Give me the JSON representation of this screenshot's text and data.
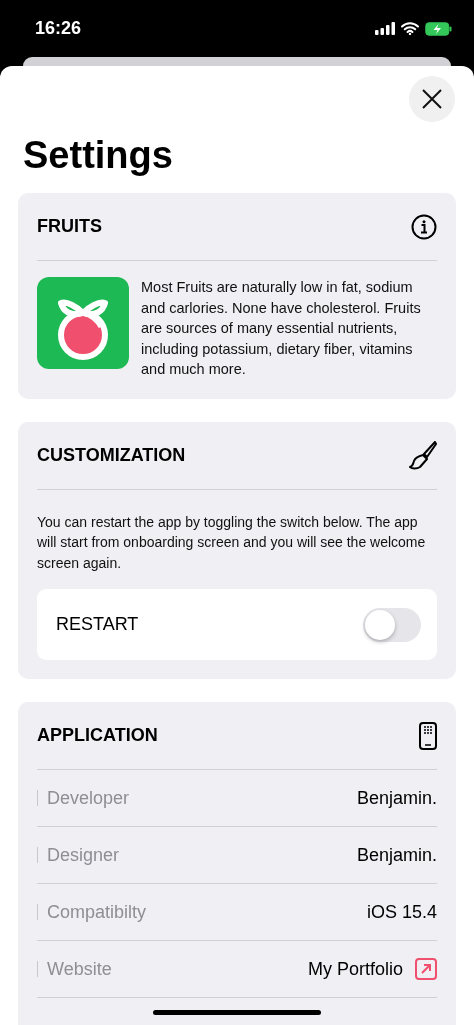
{
  "status_bar": {
    "time": "16:26"
  },
  "title": "Settings",
  "fruits": {
    "heading": "FRUITS",
    "text": "Most Fruits are naturally low in fat, sodium and carlories. None have cholesterol. Fruits are sources of many essential nutrients, including potassium, dietary fiber, vitamins and much more."
  },
  "customization": {
    "heading": "CUSTOMIZATION",
    "text": "You can restart the app by toggling the switch below. The app will start from onboarding screen and you will see the welcome screen again.",
    "toggle": {
      "label": "RESTART",
      "on": false
    }
  },
  "application": {
    "heading": "APPLICATION",
    "rows": [
      {
        "kind": "text",
        "label": "Developer",
        "value": "Benjamin."
      },
      {
        "kind": "text",
        "label": "Designer",
        "value": "Benjamin."
      },
      {
        "kind": "text",
        "label": "Compatibilty",
        "value": "iOS 15.4"
      },
      {
        "kind": "link",
        "label": "Website",
        "value": "My Portfolio"
      }
    ]
  }
}
